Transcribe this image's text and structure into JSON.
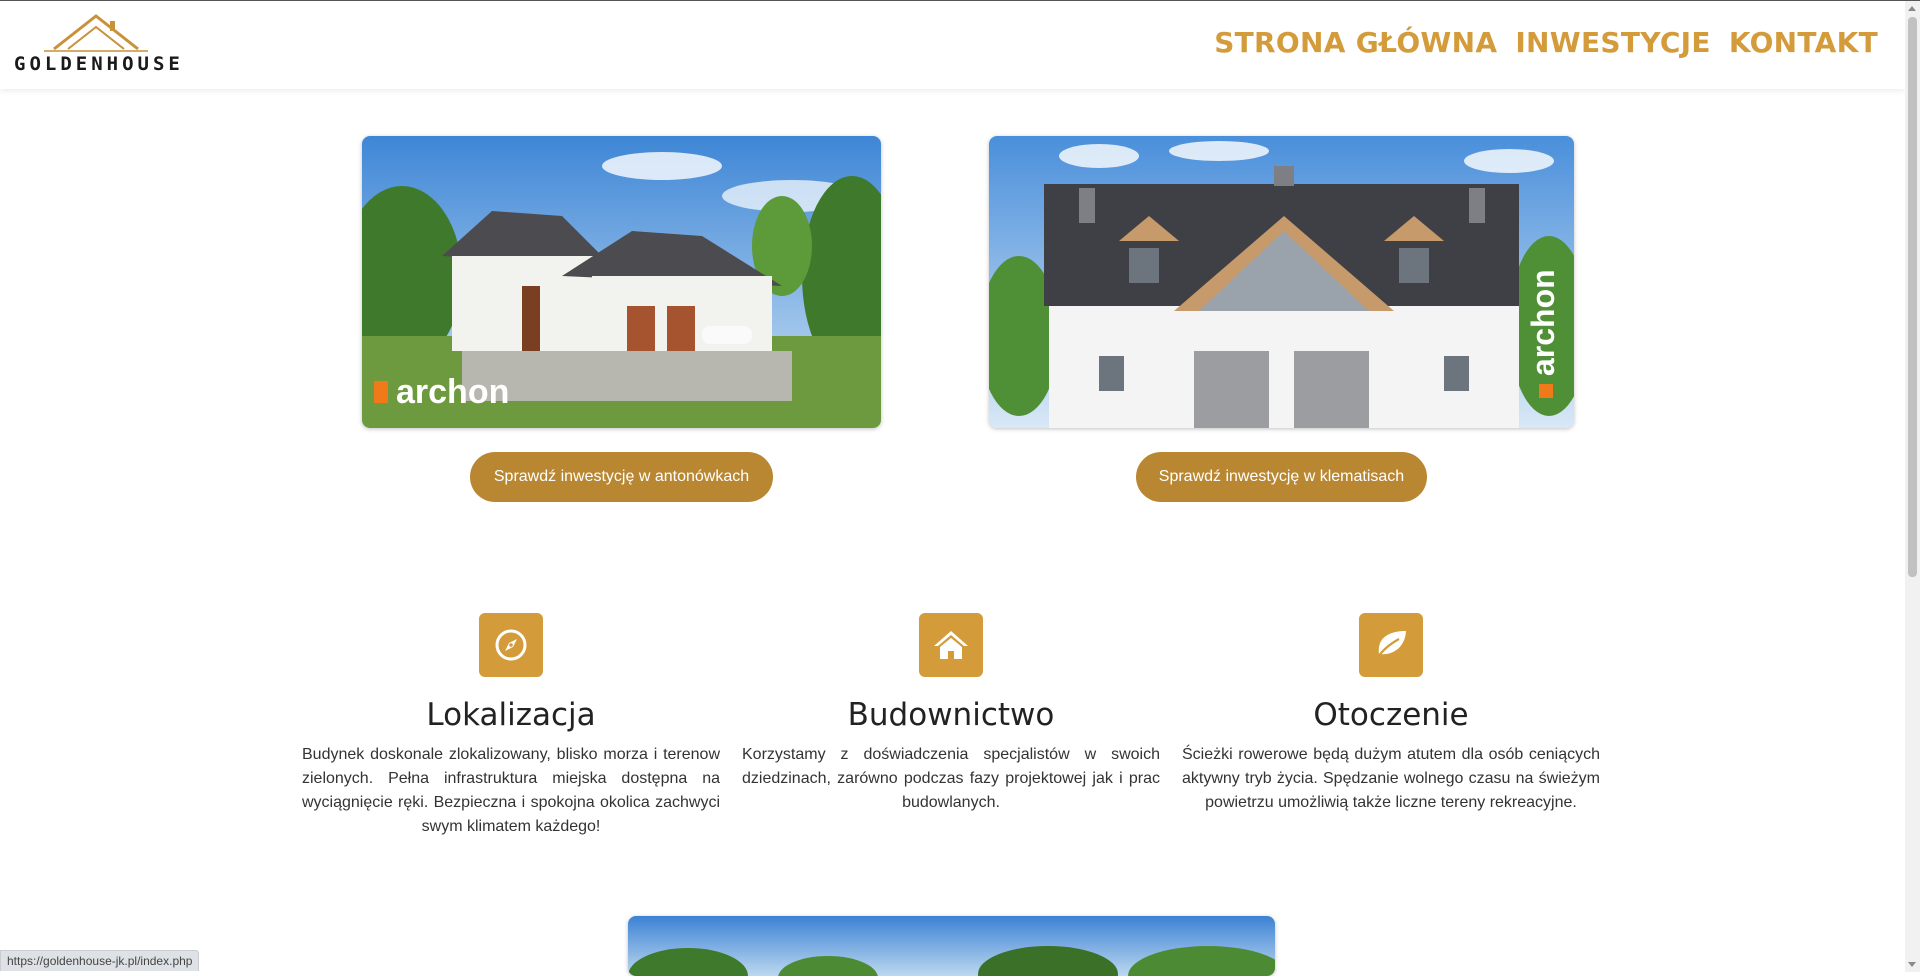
{
  "header": {
    "logo_text": "GOLDENHOUSE",
    "nav": [
      "STRONA GŁÓWNA",
      "INWESTYCJE",
      "KONTAKT"
    ]
  },
  "investments": [
    {
      "button_label": "Sprawdź inwestycję w antonówkach",
      "watermark": "archon"
    },
    {
      "button_label": "Sprawdź inwestycję w klematisach",
      "watermark": "archon"
    }
  ],
  "features": [
    {
      "icon": "compass-icon",
      "title": "Lokalizacja",
      "text": "Budynek doskonale zlokalizowany, blisko morza i terenow zielonych. Pełna infrastruktura miejska dostępna na wyciągnięcie ręki. Bezpieczna i spokojna okolica zachwyci swym klimatem każdego!"
    },
    {
      "icon": "home-icon",
      "title": "Budownictwo",
      "text": "Korzystamy z doświadczenia specjalistów w swoich dziedzinach, zarówno podczas fazy projektowej jak i prac budowlanych."
    },
    {
      "icon": "leaf-icon",
      "title": "Otoczenie",
      "text": "Ścieżki rowerowe będą dużym atutem dla osób ceniących aktywny tryb życia. Spędzanie wolnego czasu na świeżym powietrzu umożliwią także liczne tereny rekreacyjne."
    }
  ],
  "status_bar": {
    "url": "https://goldenhouse-jk.pl/index.php"
  },
  "colors": {
    "accent": "#d39b3a",
    "button": "#b98732"
  }
}
